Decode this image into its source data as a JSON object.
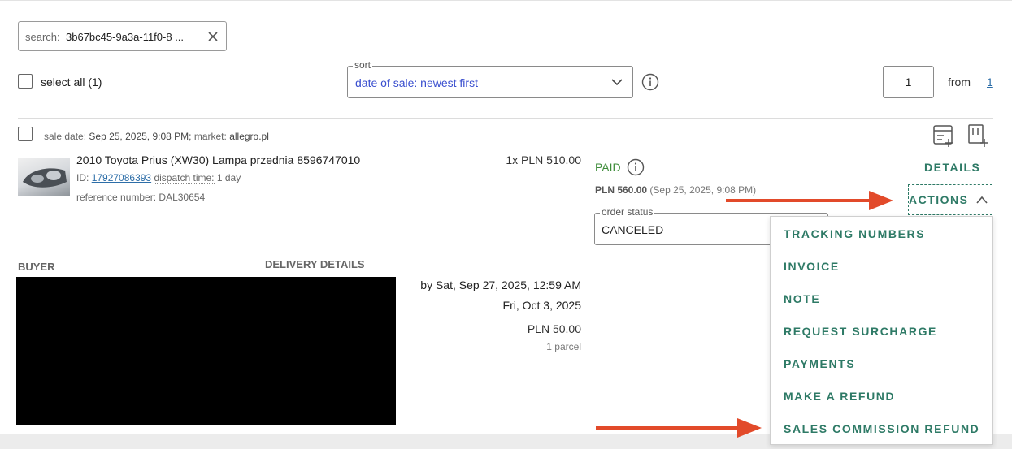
{
  "search": {
    "prefix": "search:",
    "value": "3b67bc45-9a3a-11f0-8 ...",
    "clear_icon": "close-icon"
  },
  "select_all": {
    "label": "select all (1)"
  },
  "sort": {
    "legend": "sort",
    "value": "date of sale: newest first"
  },
  "pagination": {
    "page": "1",
    "from_label": "from",
    "total": "1"
  },
  "order": {
    "sale_date_label": "sale date:",
    "sale_date": "Sep 25, 2025, 9:08 PM;",
    "market_label": "market:",
    "market": "allegro.pl",
    "item_title": "2010 Toyota Prius (XW30) Lampa przednia 8596747010",
    "id_label": "ID:",
    "id": "17927086393",
    "dispatch_label": "dispatch time:",
    "dispatch_value": "1 day",
    "reference_label": "reference number:",
    "reference": "DAL30654",
    "qty_price": "1x PLN 510.00",
    "payment_status": "PAID",
    "total": "PLN 560.00",
    "total_date": "(Sep 25, 2025, 9:08 PM)",
    "order_status_legend": "order status",
    "order_status": "CANCELED",
    "details_label": "DETAILS",
    "actions_label": "ACTIONS"
  },
  "actions_menu": [
    "TRACKING NUMBERS",
    "INVOICE",
    "NOTE",
    "REQUEST SURCHARGE",
    "PAYMENTS",
    "MAKE A REFUND",
    "SALES COMMISSION REFUND"
  ],
  "buyer": {
    "heading": "BUYER"
  },
  "delivery": {
    "heading": "DELIVERY DETAILS",
    "by_date": "by Sat, Sep 27, 2025, 12:59 AM",
    "date2": "Fri, Oct 3, 2025",
    "cost": "PLN 50.00",
    "parcels": "1 parcel"
  },
  "colors": {
    "accent": "#2e7a66",
    "link": "#2d6ea8",
    "paid": "#3e8c3a",
    "sort_text": "#3a4fcf",
    "annotation_arrow": "#e24a2a"
  }
}
